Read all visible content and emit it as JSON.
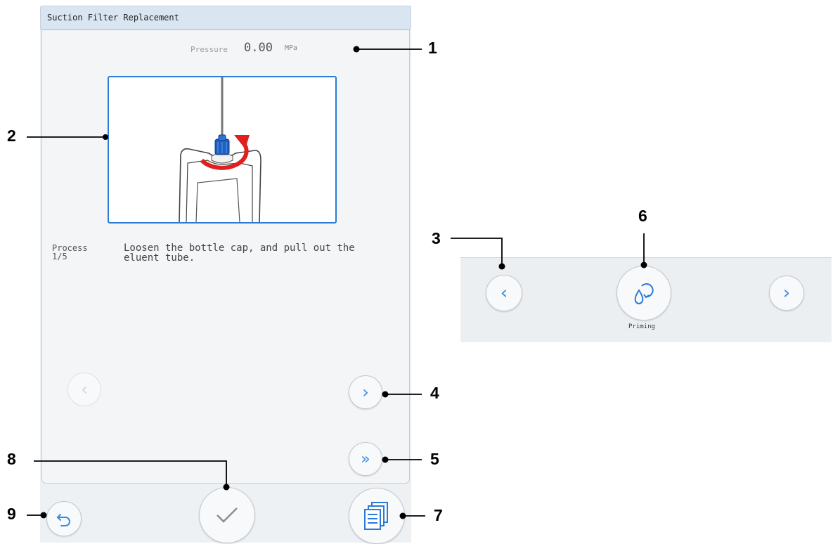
{
  "screen": {
    "title": "Suction Filter Replacement",
    "pressure": {
      "label": "Pressure",
      "value": "0.00",
      "unit": "MPa"
    },
    "process": {
      "label_line1": "Process",
      "label_line2": "1/5",
      "instruction_line1": "Loosen the bottle cap, and pull out the",
      "instruction_line2": "eluent tube."
    },
    "buttons": {
      "prev": "‹",
      "next": "›",
      "skip": "»",
      "back_icon": "back-arrow-icon",
      "confirm_icon": "checkmark-icon",
      "manual_icon": "document-list-icon"
    }
  },
  "inset": {
    "prev": "‹",
    "next": "›",
    "priming_label": "Priming",
    "priming_icon": "droplet-refresh-icon"
  },
  "callouts": {
    "c1": "1",
    "c2": "2",
    "c3": "3",
    "c4": "4",
    "c5": "5",
    "c6": "6",
    "c7": "7",
    "c8": "8",
    "c9": "9"
  },
  "colors": {
    "accent": "#2a7ad6",
    "title_bar": "#d9e6f2",
    "cap_arrow": "#e02020",
    "cap": "#1f5fc0"
  }
}
